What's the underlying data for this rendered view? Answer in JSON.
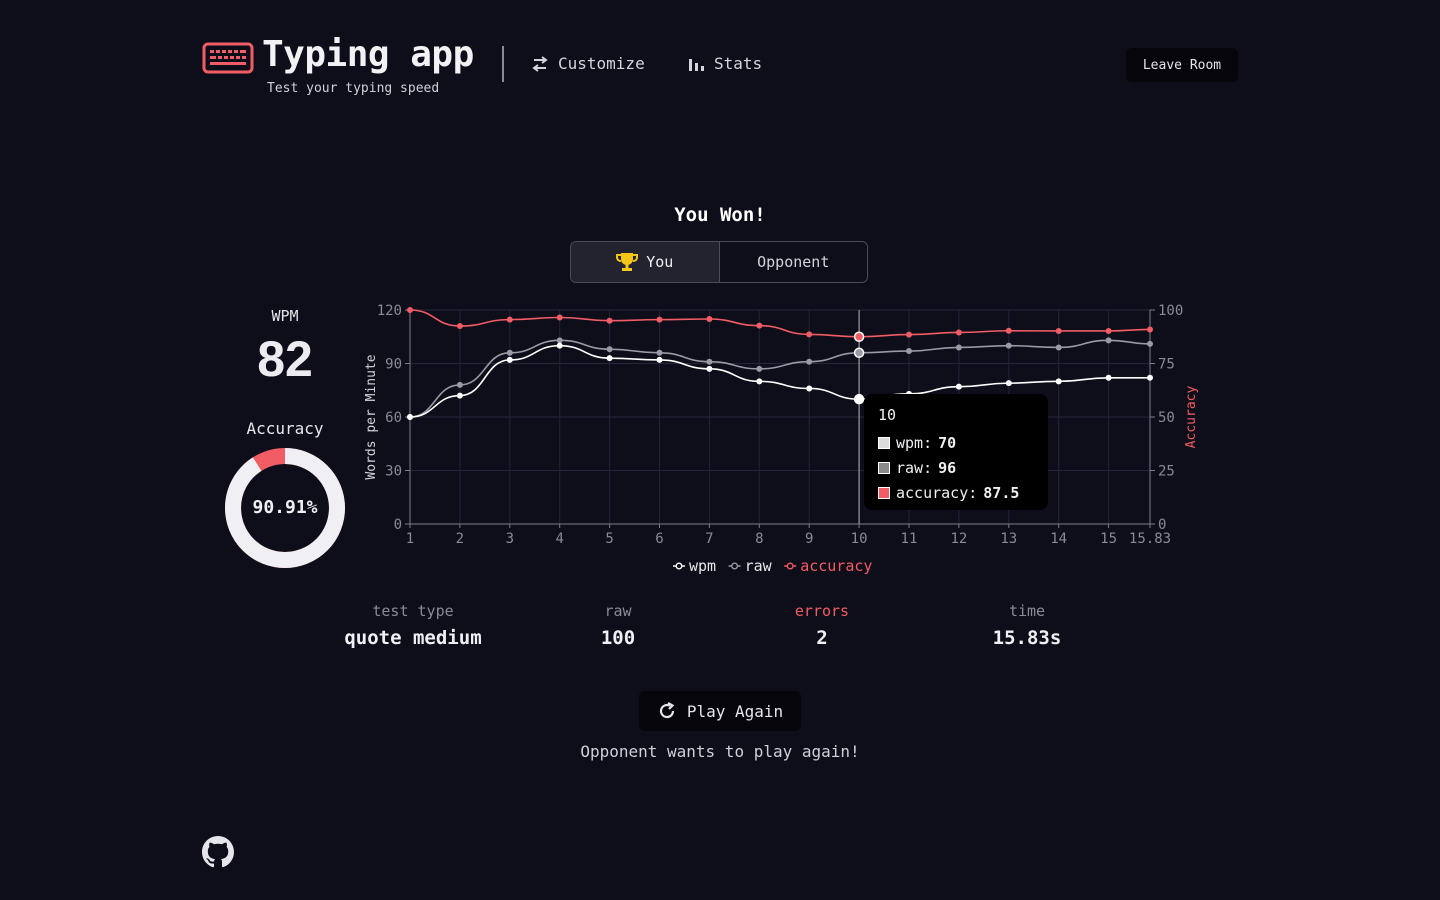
{
  "header": {
    "title": "Typing app",
    "subtitle": "Test your typing speed",
    "nav": [
      {
        "label": "Customize",
        "icon": "sliders-icon"
      },
      {
        "label": "Stats",
        "icon": "bar-chart-icon"
      }
    ],
    "leave_label": "Leave Room"
  },
  "result": {
    "title": "You Won!",
    "tabs": [
      {
        "label": "You",
        "active": true,
        "icon": "trophy-icon"
      },
      {
        "label": "Opponent",
        "active": false
      }
    ]
  },
  "summary": {
    "wpm_label": "WPM",
    "wpm_value": "82",
    "accuracy_label": "Accuracy",
    "accuracy_value": "90.91%",
    "accuracy_fraction": 0.9091
  },
  "chart_data": {
    "type": "line",
    "x": [
      1,
      2,
      3,
      4,
      5,
      6,
      7,
      8,
      9,
      10,
      11,
      12,
      13,
      14,
      15,
      15.83
    ],
    "x_tick_labels": [
      "1",
      "2",
      "3",
      "4",
      "5",
      "6",
      "7",
      "8",
      "9",
      "10",
      "11",
      "12",
      "13",
      "14",
      "15",
      "15.83"
    ],
    "series": [
      {
        "name": "wpm",
        "axis": "left",
        "color": "#ffffff",
        "values": [
          60,
          72,
          92,
          100,
          93,
          92,
          87,
          80,
          76,
          70,
          73,
          77,
          79,
          80,
          82,
          82
        ]
      },
      {
        "name": "raw",
        "axis": "left",
        "color": "#9a9aa6",
        "values": [
          60,
          78,
          96,
          103,
          98,
          96,
          91,
          87,
          91,
          96,
          97,
          99,
          100,
          99,
          103,
          101
        ]
      },
      {
        "name": "accuracy",
        "axis": "right",
        "color": "#f25c64",
        "values": [
          100,
          92.5,
          95.5,
          96.5,
          95,
          95.5,
          95.8,
          92.7,
          88.6,
          87.5,
          88.5,
          89.5,
          90.3,
          90.2,
          90.2,
          90.9
        ]
      }
    ],
    "ylabel": "Words per Minute",
    "y2label": "Accuracy",
    "ylim": [
      0,
      120
    ],
    "yticks": [
      0,
      30,
      60,
      90,
      120
    ],
    "y2lim": [
      0,
      100
    ],
    "y2ticks": [
      0,
      25,
      50,
      75,
      100
    ],
    "grid": true,
    "legend_position": "bottom",
    "hover_index": 9,
    "tooltip": {
      "title": "10",
      "rows": [
        {
          "label": "wpm:",
          "value": "70",
          "color": "#dcdcdc"
        },
        {
          "label": "raw:",
          "value": "96",
          "color": "#8a8a8a"
        },
        {
          "label": "accuracy:",
          "value": "87.5",
          "color": "#f25c64"
        }
      ]
    }
  },
  "stats": [
    {
      "label": "test type",
      "value": "quote medium",
      "label_color": "#8a8a96"
    },
    {
      "label": "raw",
      "value": "100",
      "label_color": "#8a8a96"
    },
    {
      "label": "errors",
      "value": "2",
      "label_color": "#f25c64"
    },
    {
      "label": "time",
      "value": "15.83s",
      "label_color": "#8a8a96"
    }
  ],
  "play_again_label": "Play Again",
  "opponent_message": "Opponent wants to play again!",
  "colors": {
    "accent": "#f25c64",
    "background": "#0e0e1a"
  }
}
